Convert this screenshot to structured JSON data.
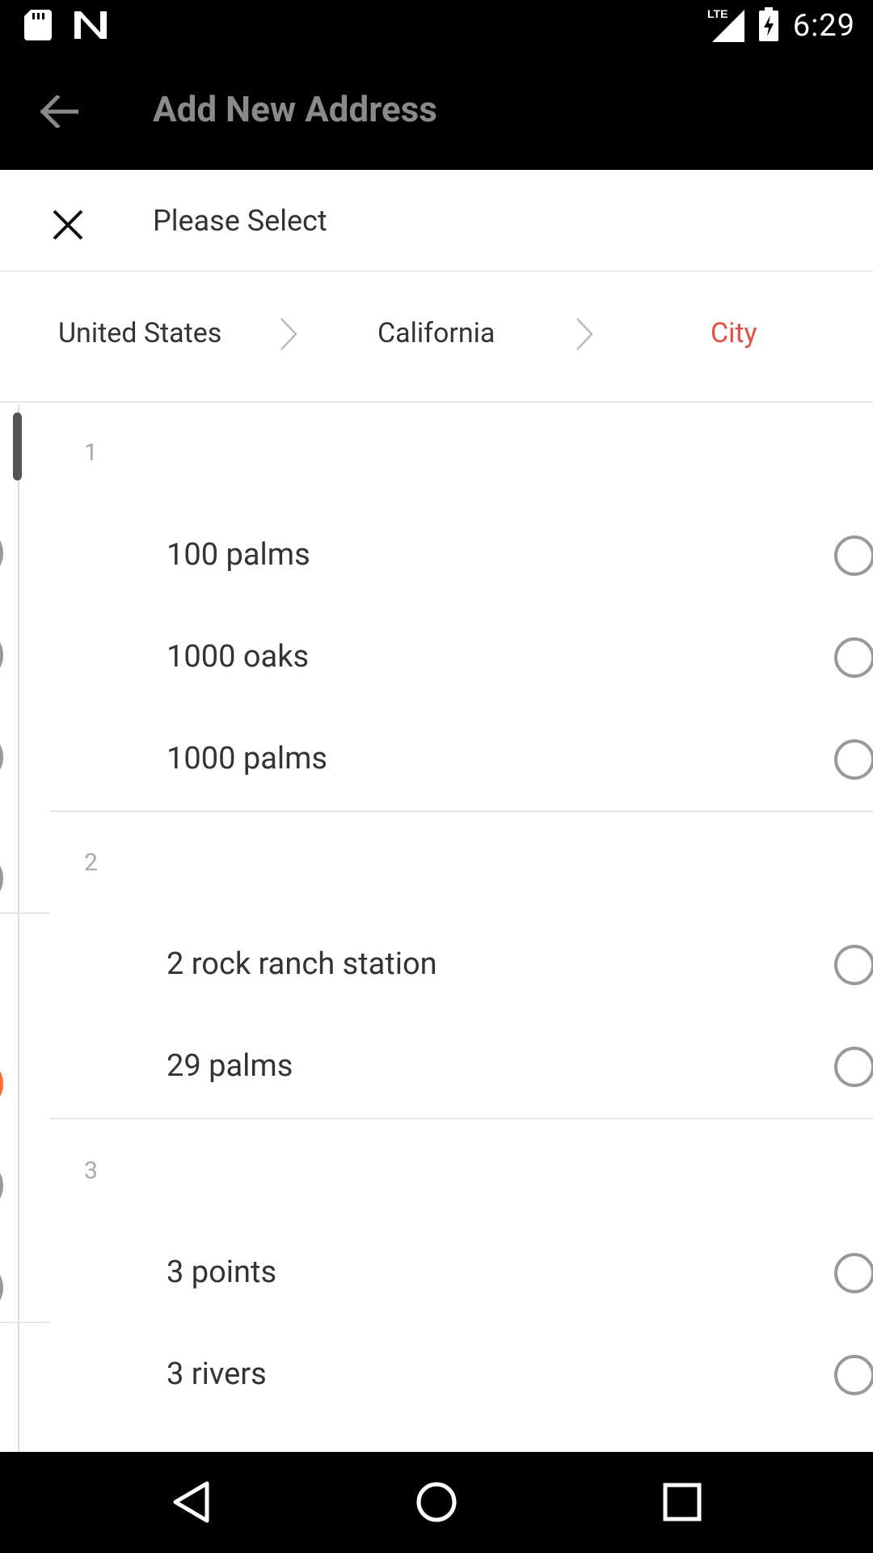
{
  "status_bar": {
    "time": "6:29",
    "network": "LTE"
  },
  "app_bar": {
    "title": "Add New Address"
  },
  "sheet": {
    "title": "Please Select",
    "breadcrumbs": [
      {
        "label": "United States",
        "active": false
      },
      {
        "label": "California",
        "active": false
      },
      {
        "label": "City",
        "active": true
      }
    ]
  },
  "sections": [
    {
      "label": "1",
      "items": [
        "100 palms",
        "1000 oaks",
        "1000 palms"
      ]
    },
    {
      "label": "2",
      "items": [
        "2 rock ranch station",
        "29 palms"
      ]
    },
    {
      "label": "3",
      "items": [
        "3 points",
        "3 rivers"
      ]
    }
  ],
  "colors": {
    "accent": "#e54d42",
    "selected_dot": "#ff6b33"
  }
}
